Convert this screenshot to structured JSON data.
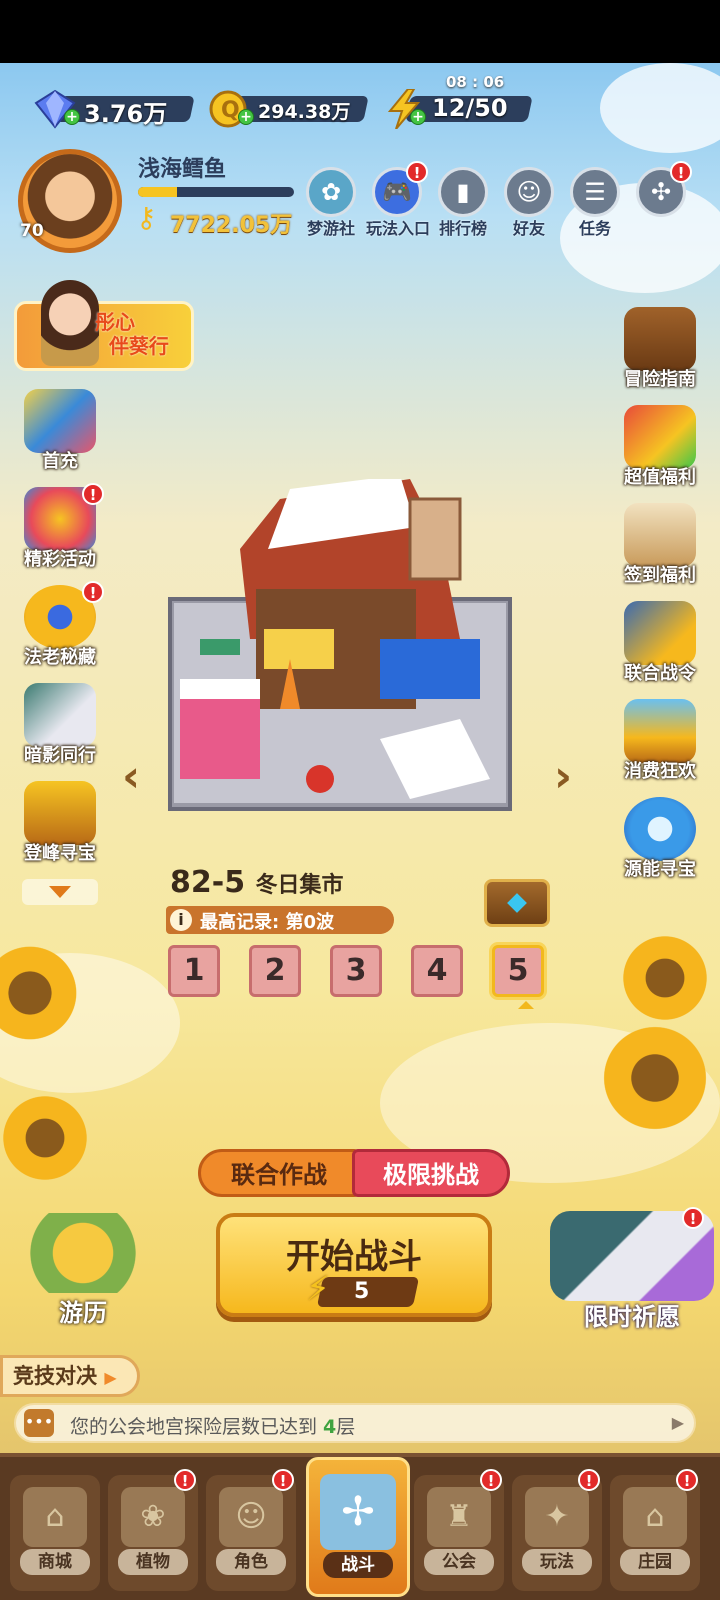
{
  "resources": {
    "diamonds": "3.76万",
    "coins": "294.38万",
    "energy": "12/50",
    "energy_timer": "08 : 06"
  },
  "player": {
    "name": "浅海鳕鱼",
    "level": "70",
    "keys": "7722.05万",
    "xp_fraction": 0.25
  },
  "top_icons": [
    {
      "label": "梦游社",
      "icon": "dream-club-icon",
      "badge": ""
    },
    {
      "label": "玩法入口",
      "icon": "gamepad-icon",
      "badge": "!"
    },
    {
      "label": "排行榜",
      "icon": "leaderboard-icon",
      "badge": ""
    },
    {
      "label": "好友",
      "icon": "friends-icon",
      "badge": ""
    },
    {
      "label": "任务",
      "icon": "tasks-icon",
      "badge": ""
    },
    {
      "label": "",
      "icon": "more-icon",
      "badge": "!"
    }
  ],
  "banner": {
    "text_line1": "彤心",
    "text_line2": "伴葵行"
  },
  "left_side": [
    {
      "label": "首充",
      "badge": ""
    },
    {
      "label": "精彩活动",
      "badge": "!"
    },
    {
      "label": "法老秘藏",
      "badge": "!"
    },
    {
      "label": "暗影同行",
      "badge": ""
    },
    {
      "label": "登峰寻宝",
      "badge": ""
    }
  ],
  "right_side": [
    {
      "label": "冒险指南"
    },
    {
      "label": "超值福利"
    },
    {
      "label": "签到福利"
    },
    {
      "label": "联合战令"
    },
    {
      "label": "消费狂欢"
    },
    {
      "label": "源能寻宝"
    }
  ],
  "stage": {
    "code": "82-5",
    "name": "冬日集市",
    "record": "最高记录: 第0波",
    "waves": [
      "1",
      "2",
      "3",
      "4",
      "5"
    ],
    "selected_wave": "5"
  },
  "modes": {
    "coop": "联合作战",
    "limit": "极限挑战"
  },
  "start": {
    "label": "开始战斗",
    "cost": "5"
  },
  "travel": {
    "label": "游历"
  },
  "wish": {
    "label": "限时祈愿",
    "badge": "!"
  },
  "arena": {
    "label": "竞技对决"
  },
  "notice": {
    "prefix": "您的公会地宫探险层数已达到 ",
    "value": "4",
    "suffix": "层"
  },
  "nav": [
    {
      "label": "商城",
      "badge": ""
    },
    {
      "label": "植物",
      "badge": "!"
    },
    {
      "label": "角色",
      "badge": "!"
    },
    {
      "label": "战斗",
      "badge": ""
    },
    {
      "label": "公会",
      "badge": "!"
    },
    {
      "label": "玩法",
      "badge": "!"
    },
    {
      "label": "庄园",
      "badge": "!"
    }
  ],
  "colors": {
    "accent": "#f6b81d",
    "badge": "#e22a2a",
    "nav_bg": "#5a3a22"
  }
}
